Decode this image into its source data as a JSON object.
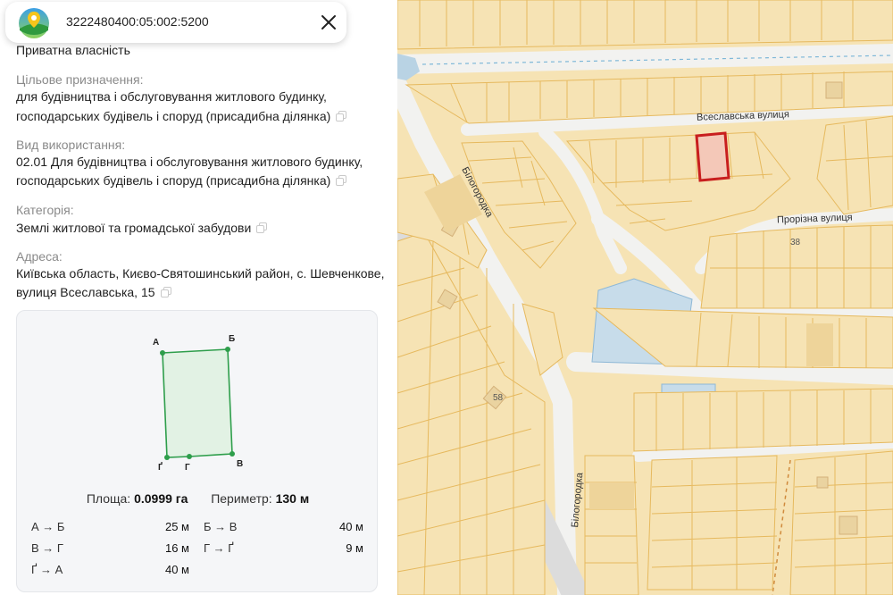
{
  "header": {
    "cadastral_number": "3222480400:05:002:5200",
    "logo_icon": "map-pin-logo-icon",
    "close_icon": "close-icon"
  },
  "details": {
    "ownership": "Приватна власність",
    "purpose_label": "Цільове призначення:",
    "purpose_line1": "для будівництва і обслуговування житлового будинку,",
    "purpose_line2": "господарських будівель і споруд (присадибна ділянка)",
    "usage_label": "Вид використання:",
    "usage_line1": "02.01 Для будівництва і обслуговування житлового будинку,",
    "usage_line2": "господарських будівель і споруд (присадибна ділянка)",
    "category_label": "Категорія:",
    "category_value": "Землі житлової та громадської забудови",
    "address_label": "Адреса:",
    "address_line1": "Київська область, Києво-Святошинський район, с. Шевченкове,",
    "address_line2": "вулиця Всеславська, 15"
  },
  "plot": {
    "vertices": [
      "А",
      "Б",
      "В",
      "Г",
      "Ґ"
    ],
    "area_label": "Площа:",
    "area_value": "0.0999 га",
    "perimeter_label": "Периметр:",
    "perimeter_value": "130 м",
    "segments": [
      {
        "name": "А → Б",
        "value": "25 м"
      },
      {
        "name": "Б → В",
        "value": "40 м"
      },
      {
        "name": "В → Г",
        "value": "16 м"
      },
      {
        "name": "Г → Ґ",
        "value": "9 м"
      },
      {
        "name": "Ґ → А",
        "value": "40 м"
      }
    ]
  },
  "map": {
    "streets": {
      "vseslavska": "Всеславська вулиця",
      "prorizna": "Прорізна вулиця",
      "bilogorodka_1": "Білогородка",
      "bilogorodka_2": "Білогородка"
    },
    "house_numbers": [
      "38",
      "58"
    ],
    "colors": {
      "parcel_fill": "#f6e3b4",
      "parcel_line": "#e6b95e",
      "road": "#f2f2f0",
      "selected_outline": "#c81e1e",
      "selected_fill": "#f4c8b8",
      "water": "#b9d3e4",
      "plot_shape": "#2e9e4b"
    }
  }
}
